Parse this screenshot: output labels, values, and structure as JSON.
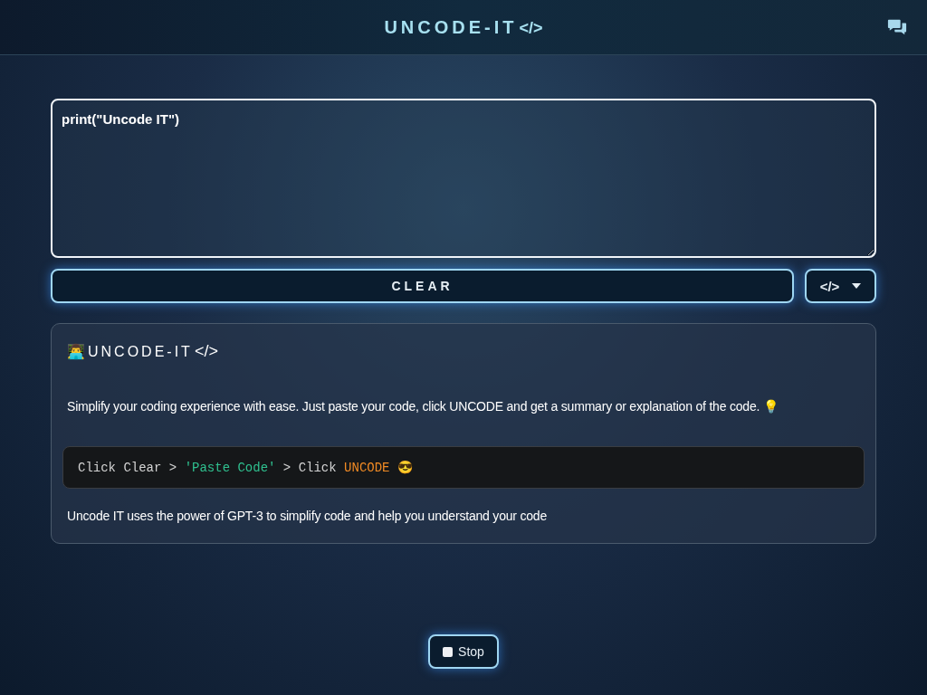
{
  "header": {
    "title": "UNCODE-IT",
    "title_suffix": "</>"
  },
  "editor": {
    "value": "print(\"Uncode IT\")"
  },
  "clear_button": "CLEAR",
  "language_select": {
    "value": "</>"
  },
  "info": {
    "emoji": "👨‍💻",
    "title": "UNCODE-IT",
    "title_suffix": "</>",
    "intro": "Simplify your coding experience with ease. Just paste your code, click UNCODE and get a summary or explanation of the code. 💡",
    "code_segments": [
      {
        "kind": "plain",
        "text": "Click Clear > "
      },
      {
        "kind": "string",
        "text": "'Paste Code'"
      },
      {
        "kind": "plain",
        "text": " > Click "
      },
      {
        "kind": "keyword",
        "text": "UNCODE"
      },
      {
        "kind": "plain",
        "text": " 😎"
      }
    ],
    "footer": "Uncode IT uses the power of GPT-3 to simplify code and help you understand your code"
  },
  "stop_button": "Stop"
}
